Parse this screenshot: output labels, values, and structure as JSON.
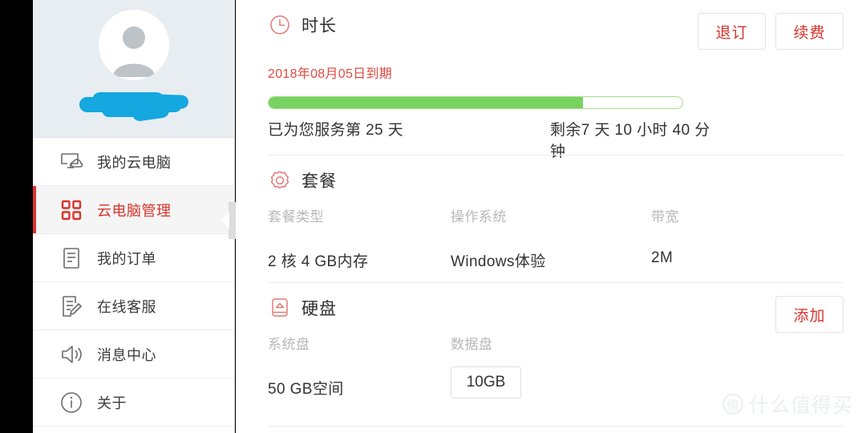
{
  "sidebar": {
    "profile": {
      "avatar_icon": "user-avatar-icon",
      "username_redacted": "",
      "redaction_color": "#15a7e0"
    },
    "items": [
      {
        "icon": "monitor-cloud-icon",
        "label": "我的云电脑",
        "active": false
      },
      {
        "icon": "grid-squares-icon",
        "label": "云电脑管理",
        "active": true
      },
      {
        "icon": "document-lines-icon",
        "label": "我的订单",
        "active": false
      },
      {
        "icon": "document-edit-icon",
        "label": "在线客服",
        "active": false
      },
      {
        "icon": "speaker-icon",
        "label": "消息中心",
        "active": false
      },
      {
        "icon": "info-circle-icon",
        "label": "关于",
        "active": false
      }
    ],
    "collapse_handle_icon": "chevron-left-icon"
  },
  "main": {
    "duration": {
      "icon": "clock-icon",
      "title": "时长",
      "buttons": [
        {
          "label": "退订",
          "name": "unsubscribe-button"
        },
        {
          "label": "续费",
          "name": "renew-button"
        }
      ],
      "expire_text": "2018年08月05日到期",
      "progress_percent": 76,
      "served_text": "已为您服务第 25 天",
      "remaining_text": "剩余7 天 10 小时 40 分钟",
      "bar_fill_color": "#78d25f",
      "bar_border_color": "#a6dd8a"
    },
    "package": {
      "icon": "gear-outline-icon",
      "title": "套餐",
      "columns": [
        {
          "header": "套餐类型",
          "value": "2 核 4 GB内存"
        },
        {
          "header": "操作系统",
          "value": "Windows体验"
        },
        {
          "header": "带宽",
          "value": "2M"
        }
      ]
    },
    "disk": {
      "icon": "harddisk-icon",
      "title": "硬盘",
      "button": {
        "label": "添加",
        "name": "add-disk-button"
      },
      "columns": [
        {
          "header": "系统盘",
          "value": "50 GB空间",
          "type": "text"
        },
        {
          "header": "数据盘",
          "value": "10GB",
          "type": "chip"
        }
      ]
    }
  },
  "watermark": {
    "badge": "值",
    "text": "什么值得买"
  },
  "theme": {
    "accent_red": "#d9342b",
    "profile_bg": "#e8edf2",
    "muted_text": "#b8b8b8"
  }
}
